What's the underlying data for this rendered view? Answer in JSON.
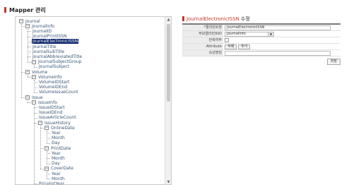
{
  "page": {
    "title": "Mapper 관리"
  },
  "tree": {
    "nodes": [
      {
        "label": "Journal",
        "expander": "−"
      },
      {
        "label": "JournalInfo",
        "expander": "−"
      },
      {
        "label": "JournalID"
      },
      {
        "label": "JournalPrintISSN"
      },
      {
        "label": "JournalElectronicISSN",
        "selected": true
      },
      {
        "label": "JournalTitle"
      },
      {
        "label": "JournalSubTitle"
      },
      {
        "label": "JournalAbbreviatedTitle"
      },
      {
        "label": "JournalSubjectGroup",
        "expander": "−"
      },
      {
        "label": "JournalSubject"
      },
      {
        "label": "Volume",
        "expander": "−"
      },
      {
        "label": "VolumeInfo",
        "expander": "−"
      },
      {
        "label": "VolumeIDStart"
      },
      {
        "label": "VolumeIDEnd"
      },
      {
        "label": "VolumeIssueCount"
      },
      {
        "label": "Issue",
        "expander": "−"
      },
      {
        "label": "IssueInfo",
        "expander": "−"
      },
      {
        "label": "IssueIDStart"
      },
      {
        "label": "IssueIDEnd"
      },
      {
        "label": "IssueArticleCount"
      },
      {
        "label": "IssueHistory",
        "expander": "−"
      },
      {
        "label": "OnlineDate",
        "expander": "−"
      },
      {
        "label": "Year"
      },
      {
        "label": "Month"
      },
      {
        "label": "Day"
      },
      {
        "label": "PrintDate",
        "expander": "−"
      },
      {
        "label": "Year"
      },
      {
        "label": "Month"
      },
      {
        "label": "Day"
      },
      {
        "label": "CoverDate",
        "expander": "−"
      },
      {
        "label": "Year"
      },
      {
        "label": "Month"
      },
      {
        "label": "PricelistYear"
      }
    ]
  },
  "form": {
    "title": "JournalElectronicISSN",
    "title_suffix": "수정",
    "rows": {
      "element_name": {
        "label": "*엘리먼트명",
        "value": "JournalElectronicISSN"
      },
      "parent_element": {
        "label": "부모엘리먼트ID",
        "value": "JournalInfo"
      },
      "repeat": {
        "label": "반복여부"
      },
      "attribute": {
        "label": "Attribute",
        "delete_label": "삭제",
        "add_label": "추가"
      },
      "property": {
        "label": "속성명칭",
        "value": ""
      }
    },
    "save_label": "저장"
  },
  "colors": {
    "accent": "#c0392b",
    "selected_bg": "#0a246a",
    "tree_text": "#3a5878"
  },
  "icons": {
    "expander": "minus-box-icon",
    "dropdown": "chevron-down-icon",
    "scroll_up": "arrow-up-icon",
    "scroll_down": "arrow-down-icon"
  }
}
